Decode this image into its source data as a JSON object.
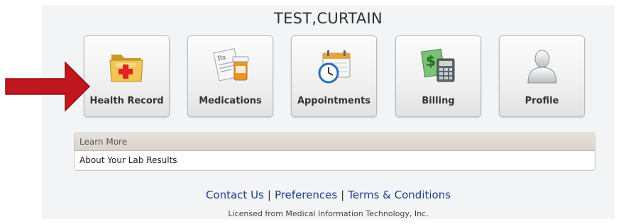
{
  "patient": {
    "name": "TEST,CURTAIN"
  },
  "tiles": [
    {
      "label": "Health Record",
      "icon": "folder-medical-icon"
    },
    {
      "label": "Medications",
      "icon": "prescription-bottle-icon"
    },
    {
      "label": "Appointments",
      "icon": "calendar-clock-icon"
    },
    {
      "label": "Billing",
      "icon": "calculator-money-icon"
    },
    {
      "label": "Profile",
      "icon": "user-silhouette-icon"
    }
  ],
  "learn_more": {
    "header": "Learn More",
    "items": [
      "About Your Lab Results"
    ]
  },
  "footer": {
    "links": [
      "Contact Us",
      "Preferences",
      "Terms & Conditions"
    ],
    "separator": "|",
    "license": "Licensed from Medical Information Technology, Inc."
  },
  "colors": {
    "arrow": "#c0161d",
    "link": "#1c3f8c",
    "panel": "#f2f4f5"
  }
}
